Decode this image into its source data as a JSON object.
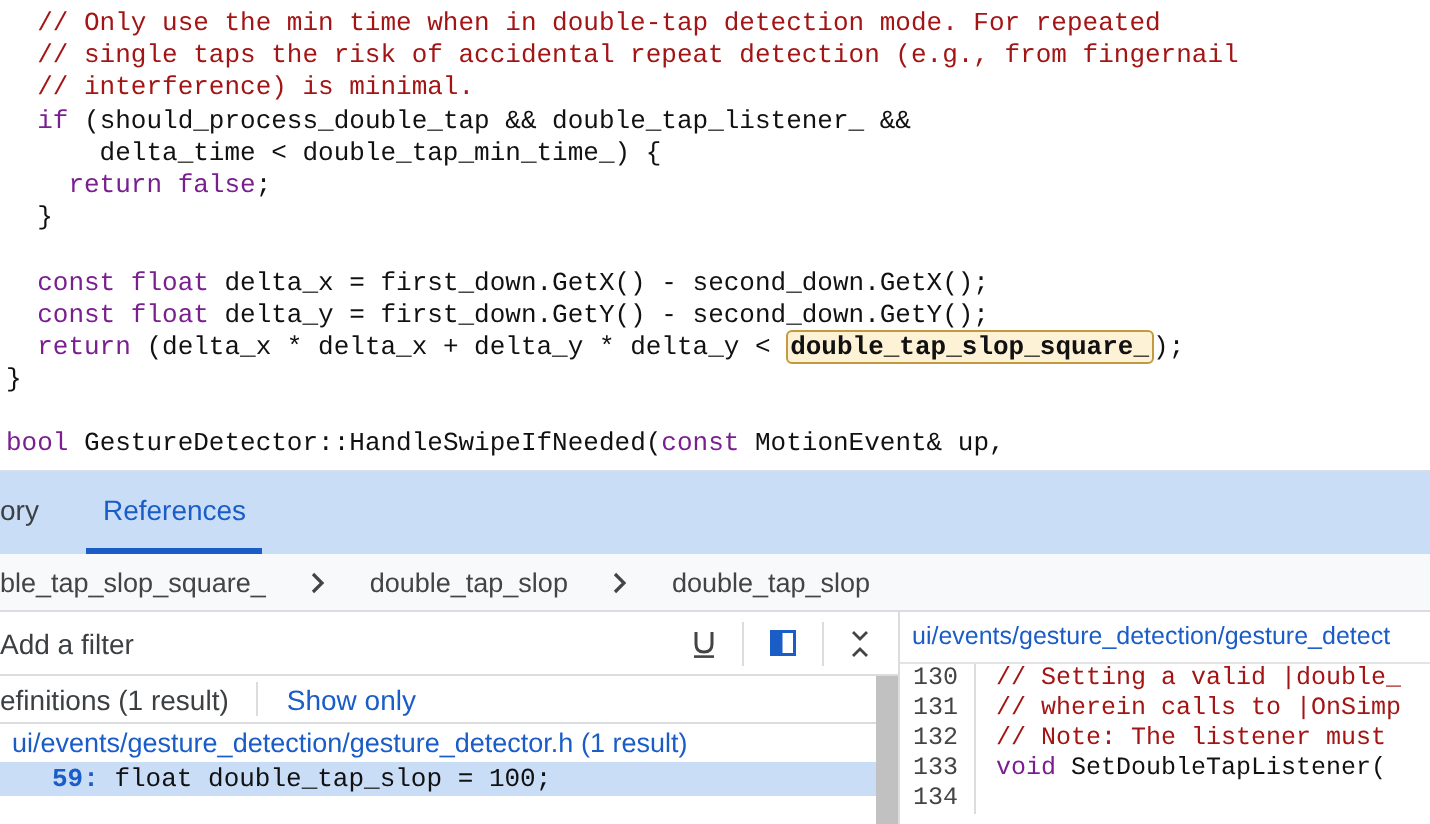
{
  "editor": {
    "lines": [
      {
        "segments": [
          {
            "kind": "comment",
            "text": "  // Only use the min time when in double-tap detection mode. For repeated"
          }
        ]
      },
      {
        "segments": [
          {
            "kind": "comment",
            "text": "  // single taps the risk of accidental repeat detection (e.g., from fingernail"
          }
        ]
      },
      {
        "segments": [
          {
            "kind": "comment",
            "text": "  // interference) is minimal."
          }
        ]
      },
      {
        "segments": [
          {
            "kind": "keyword",
            "text": "  if"
          },
          {
            "kind": "text",
            "text": " (should_process_double_tap && double_tap_listener_ &&"
          }
        ]
      },
      {
        "segments": [
          {
            "kind": "text",
            "text": "      delta_time < double_tap_min_time_) {"
          }
        ]
      },
      {
        "segments": [
          {
            "kind": "keyword",
            "text": "    return false"
          },
          {
            "kind": "text",
            "text": ";"
          }
        ]
      },
      {
        "segments": [
          {
            "kind": "text",
            "text": "  }"
          }
        ]
      },
      {
        "gap_before": true,
        "segments": [
          {
            "kind": "keyword",
            "text": "  const float"
          },
          {
            "kind": "text",
            "text": " delta_x = first_down.GetX() - second_down.GetX();"
          }
        ]
      },
      {
        "segments": [
          {
            "kind": "keyword",
            "text": "  const float"
          },
          {
            "kind": "text",
            "text": " delta_y = first_down.GetY() - second_down.GetY();"
          }
        ]
      },
      {
        "segments": [
          {
            "kind": "keyword",
            "text": "  return"
          },
          {
            "kind": "text",
            "text": " (delta_x * delta_x + delta_y * delta_y < "
          },
          {
            "kind": "match",
            "text": "double_tap_slop_square_"
          },
          {
            "kind": "text",
            "text": ");"
          }
        ]
      },
      {
        "segments": [
          {
            "kind": "text",
            "text": "}"
          }
        ]
      },
      {
        "gap_before": true,
        "segments": [
          {
            "kind": "keyword",
            "text": "bool"
          },
          {
            "kind": "text",
            "text": " GestureDetector::HandleSwipeIfNeeded("
          },
          {
            "kind": "keyword",
            "text": "const"
          },
          {
            "kind": "text",
            "text": " MotionEvent& up,"
          }
        ]
      }
    ]
  },
  "tabs": [
    {
      "label": "ory",
      "selected": false
    },
    {
      "label": "References",
      "selected": true
    }
  ],
  "breadcrumbs": [
    "ble_tap_slop_square_",
    "double_tap_slop",
    "double_tap_slop"
  ],
  "filter": {
    "placeholder": "Add a filter"
  },
  "results": {
    "section_title": "efinitions (1 result)",
    "section_action": "Show only",
    "file": "ui/events/gesture_detection/gesture_detector.h (1 result)",
    "rows": [
      {
        "line": "59:",
        "code": "float double_tap_slop = 100;",
        "selected": true
      }
    ]
  },
  "preview": {
    "path": "ui/events/gesture_detection/gesture_detect",
    "lines": [
      {
        "number": "130",
        "segments": [
          {
            "kind": "comment",
            "text": "// Setting a valid |double_"
          }
        ]
      },
      {
        "number": "131",
        "segments": [
          {
            "kind": "comment",
            "text": "// wherein calls to |OnSimp"
          }
        ]
      },
      {
        "number": "132",
        "segments": [
          {
            "kind": "comment",
            "text": "// Note: The listener must"
          }
        ]
      },
      {
        "number": "133",
        "segments": [
          {
            "kind": "keyword",
            "text": "void"
          },
          {
            "kind": "text",
            "text": " SetDoubleTapListener("
          }
        ]
      },
      {
        "number": "134"
      }
    ]
  }
}
